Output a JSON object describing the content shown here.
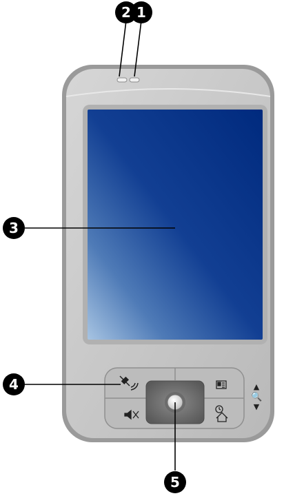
{
  "callouts": [
    {
      "number": "1",
      "part": "indicator-led-right"
    },
    {
      "number": "2",
      "part": "indicator-led-left"
    },
    {
      "number": "3",
      "part": "touch-screen"
    },
    {
      "number": "4",
      "part": "gps-button"
    },
    {
      "number": "5",
      "part": "navigation-pad"
    }
  ],
  "zoom_control": {
    "up_arrow": "▲",
    "icon": "🔍",
    "down_arrow": "▼"
  },
  "colors": {
    "body_outer": "#9a9a9a",
    "body_face": "#c9c9c9",
    "screen_bezel": "#b3b3b3",
    "screen_dark": "#002a7e",
    "screen_light": "#9cbde0",
    "callout_bg": "#000000"
  }
}
